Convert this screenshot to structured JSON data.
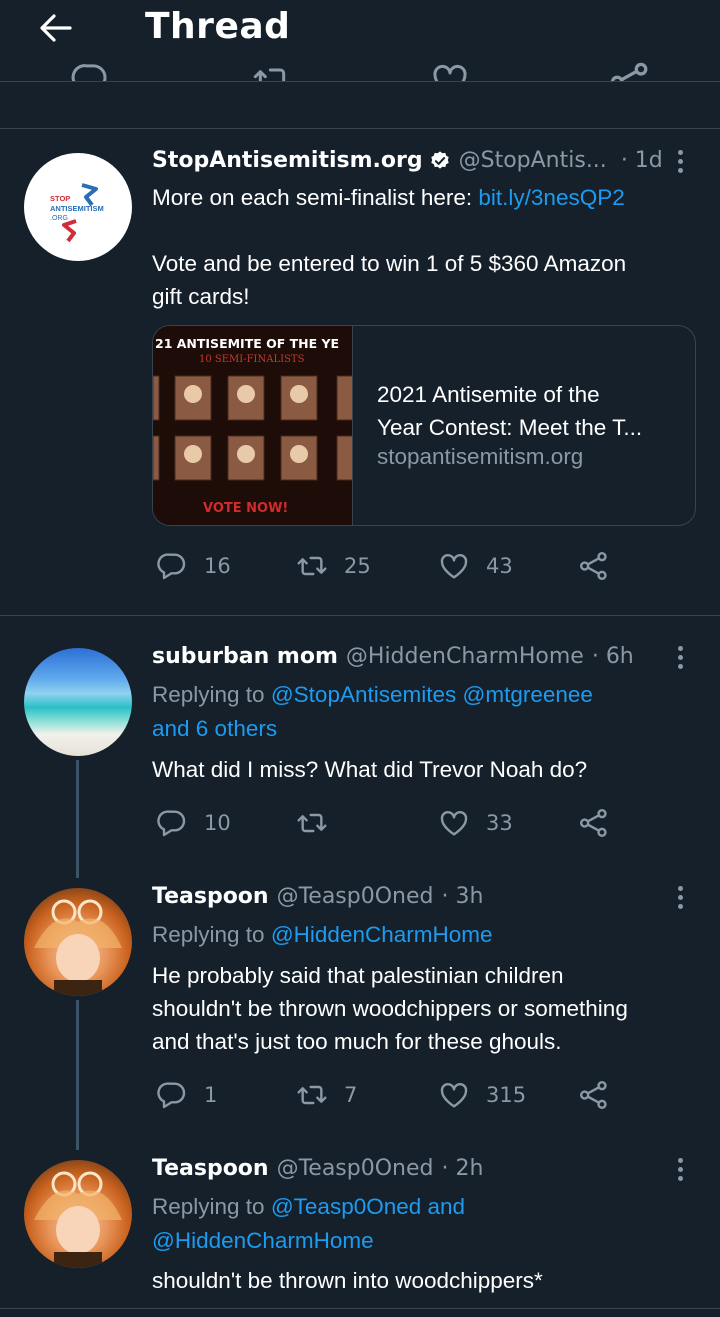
{
  "header": {
    "title": "Thread",
    "back_icon": "arrow-left-icon"
  },
  "main_tweet": {
    "name": "StopAntisemitism.org",
    "verified": true,
    "handle": "@StopAntis...",
    "time": "· 1d",
    "text_prefix": "More on each semi-finalist here: ",
    "link": "bit.ly/3nesQP2",
    "text_line2": "Vote and be entered to win 1 of 5 $360 Amazon",
    "text_line3": "gift cards!",
    "avatar_logo": {
      "line1": "STOP",
      "line2": "ANTISEMITISM",
      "line3": ".ORG"
    },
    "card": {
      "image_banner": "21 ANTISEMITE OF THE YE",
      "image_subtitle": "10 SEMI-FINALISTS",
      "image_cta": "VOTE NOW!",
      "title_line1": "2021 Antisemite of the",
      "title_line2": "Year Contest: Meet the T...",
      "domain": "stopantisemitism.org"
    },
    "replies": "16",
    "retweets": "25",
    "likes": "43"
  },
  "replies": [
    {
      "name": "suburban mom",
      "handle": "@HiddenCharmHome",
      "time": "· 6h",
      "replying_label": "Replying to ",
      "replying_to_line1": "@StopAntisemites @mtgreenee",
      "replying_to_line2": "and 6 others",
      "text_lines": [
        "What did I miss? What did Trevor Noah do?"
      ],
      "replies": "10",
      "retweets": "",
      "likes": "33"
    },
    {
      "name": "Teaspoon",
      "handle": "@Teasp0Oned",
      "time": "· 3h",
      "replying_label": "Replying to ",
      "replying_to_line1": "@HiddenCharmHome",
      "text_lines": [
        "He probably said that palestinian children",
        "shouldn't be thrown woodchippers or something",
        "and that's just too much for these ghouls."
      ],
      "replies": "1",
      "retweets": "7",
      "likes": "315"
    },
    {
      "name": "Teaspoon",
      "handle": "@Teasp0Oned",
      "time": "· 2h",
      "replying_label": "Replying to ",
      "replying_to_line1": "@Teasp0Oned and",
      "replying_to_line2": "@HiddenCharmHome",
      "text_lines": [
        "shouldn't be thrown into woodchippers*"
      ]
    }
  ],
  "colors": {
    "background": "#15202b",
    "link": "#1d9bf0",
    "muted": "#8b98a5",
    "border": "#38444d"
  }
}
